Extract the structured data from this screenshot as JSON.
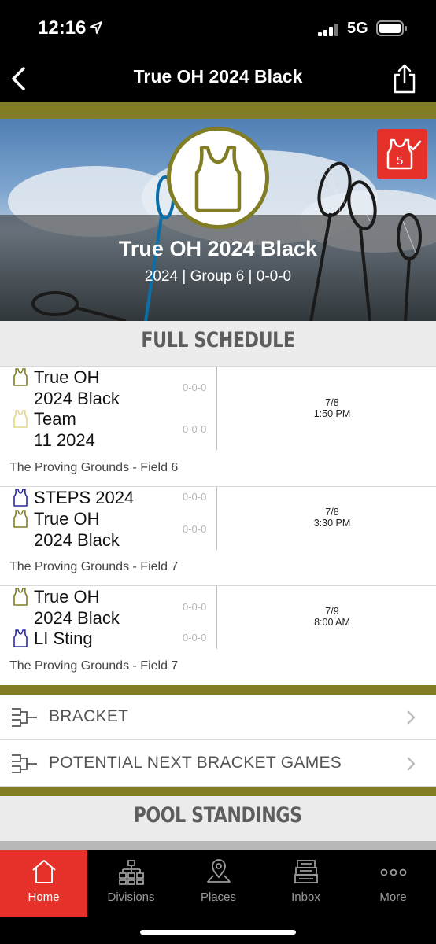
{
  "status_bar": {
    "time": "12:16",
    "network": "5G"
  },
  "nav": {
    "title": "True OH 2024 Black"
  },
  "team_header": {
    "name": "True OH 2024 Black",
    "subtitle": "2024 | Group 6 | 0-0-0",
    "favorite_badge_count": "5"
  },
  "sections": {
    "full_schedule": "FULL SCHEDULE",
    "pool_standings": "POOL STANDINGS"
  },
  "games": [
    {
      "teams": [
        {
          "name": "True OH\n2024 Black",
          "record": "0-0-0",
          "icon_color": "#817d25"
        },
        {
          "name": "Team\n11 2024",
          "record": "0-0-0",
          "icon_color": "#e2d58a"
        }
      ],
      "date": "7/8",
      "time": "1:50 PM",
      "venue": "The Proving Grounds - Field 6"
    },
    {
      "teams": [
        {
          "name": "STEPS 2024",
          "record": "0-0-0",
          "icon_color": "#2a2aa8"
        },
        {
          "name": "True OH\n2024 Black",
          "record": "0-0-0",
          "icon_color": "#817d25"
        }
      ],
      "date": "7/8",
      "time": "3:30 PM",
      "venue": "The Proving Grounds - Field 7"
    },
    {
      "teams": [
        {
          "name": "True OH\n2024 Black",
          "record": "0-0-0",
          "icon_color": "#817d25"
        },
        {
          "name": "LI Sting",
          "record": "0-0-0",
          "icon_color": "#2a2aa8"
        }
      ],
      "date": "7/9",
      "time": "8:00 AM",
      "venue": "The Proving Grounds - Field 7"
    }
  ],
  "links": [
    {
      "label": "BRACKET",
      "icon": "bracket-icon"
    },
    {
      "label": "POTENTIAL NEXT BRACKET GAMES",
      "icon": "bracket-icon"
    }
  ],
  "tabs": [
    {
      "label": "Home",
      "icon": "home-icon",
      "active": true
    },
    {
      "label": "Divisions",
      "icon": "divisions-icon",
      "active": false
    },
    {
      "label": "Places",
      "icon": "places-icon",
      "active": false
    },
    {
      "label": "Inbox",
      "icon": "inbox-icon",
      "active": false
    },
    {
      "label": "More",
      "icon": "more-icon",
      "active": false
    }
  ],
  "colors": {
    "accent": "#e6302a",
    "team_olive": "#817d25",
    "opponent_blue": "#2a2aa8"
  }
}
